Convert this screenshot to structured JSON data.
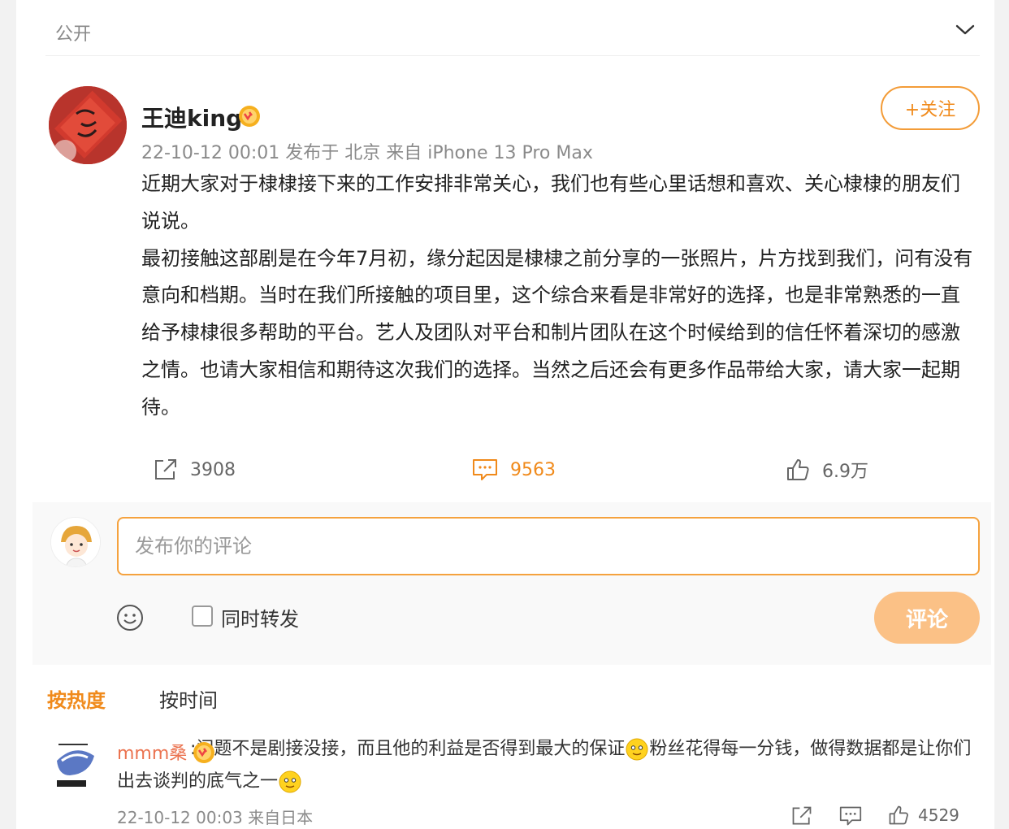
{
  "visibility": "公开",
  "post": {
    "author": "王迪king",
    "meta": "22-10-12 00:01 发布于 北京 来自 iPhone 13 Pro Max",
    "follow_label": "+关注",
    "paragraphs": [
      "近期大家对于棣棣接下来的工作安排非常关心，我们也有些心里话想和喜欢、关心棣棣的朋友们说说。",
      "最初接触这部剧是在今年7月初，缘分起因是棣棣之前分享的一张照片，片方找到我们，问有没有意向和档期。当时在我们所接触的项目里，这个综合来看是非常好的选择，也是非常熟悉的一直给予棣棣很多帮助的平台。艺人及团队对平台和制片团队在这个时候给到的信任怀着深切的感激之情。也请大家相信和期待这次我们的选择。当然之后还会有更多作品带给大家，请大家一起期待。"
    ],
    "stats": {
      "reposts": "3908",
      "comments": "9563",
      "likes": "6.9万"
    }
  },
  "composer": {
    "placeholder": "发布你的评论",
    "repost_label": "同时转发",
    "submit_label": "评论"
  },
  "sort_tabs": {
    "hot": "按热度",
    "time": "按时间"
  },
  "comments": [
    {
      "username": "mmm桑",
      "text_part1": ":问题不是剧接没接，而且他的利益是否得到最大的保证",
      "text_part2": "粉丝花得每一分钱，做得数据都是让你们出去谈判的底气之一",
      "meta": "22-10-12 00:03 来自日本",
      "likes": "4529"
    }
  ],
  "colors": {
    "accent": "#f08a1b",
    "accent_border": "#f5a23e",
    "submit_bg": "#fbc186",
    "username": "#eb7350"
  }
}
